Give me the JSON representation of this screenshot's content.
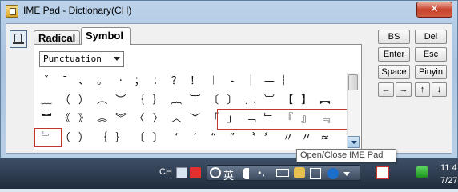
{
  "window": {
    "title": "IME Pad - Dictionary(CH)",
    "close_label": "✕"
  },
  "tabs": {
    "radical": "Radical",
    "symbol": "Symbol"
  },
  "category": {
    "selected": "Punctuation"
  },
  "symbols": {
    "row1": [
      "ˇ",
      "ˉ",
      "、",
      "。",
      "·",
      "；",
      "：",
      "？",
      "！",
      "︱",
      "‐",
      "｜",
      "—",
      "︴"
    ],
    "row2": [
      "﹏",
      "（",
      "）",
      "︵",
      "︶",
      "｛",
      "｝",
      "︷",
      "︸",
      "〔",
      "〕",
      "︹",
      "︺",
      "【",
      "】",
      "︻"
    ],
    "row3": [
      "︼",
      "《",
      "》",
      "︽",
      "︾",
      "〈",
      "〉",
      "︿",
      "﹀",
      "「",
      "」",
      "﹁",
      "﹂",
      "『",
      "』",
      "﹃"
    ],
    "row4": [
      "﹄",
      "（",
      "）",
      "｛",
      "｝",
      "〔",
      "〕",
      "‘",
      "’",
      "“",
      "”",
      "〝",
      "〞",
      "〃",
      "〃",
      "≈"
    ]
  },
  "keys": {
    "bs": "BS",
    "del": "Del",
    "enter": "Enter",
    "esc": "Esc",
    "space": "Space",
    "pinyin": "Pinyin",
    "left": "←",
    "right": "→",
    "up": "↑",
    "down": "↓"
  },
  "tooltip": "Open/Close IME Pad",
  "taskbar": {
    "lang": "CH",
    "ime_mode": "英",
    "clock_time": "11:4",
    "clock_date": "7/27"
  },
  "colors": {
    "highlight": "#c0392b",
    "taskbar": "#202c3c",
    "title_bg": "#a9c3e0"
  }
}
